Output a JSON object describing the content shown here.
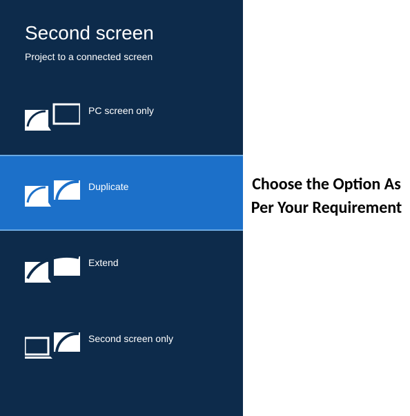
{
  "panel": {
    "title": "Second screen",
    "subtitle": "Project to a connected screen",
    "options": [
      {
        "label": "PC screen only"
      },
      {
        "label": "Duplicate"
      },
      {
        "label": "Extend"
      },
      {
        "label": "Second screen only"
      }
    ],
    "selected_index": 1
  },
  "annotation": {
    "text": "Choose the Option As Per Your Requirement"
  },
  "colors": {
    "panel_bg": "#0d2b4b",
    "selected_bg": "#1c70c9",
    "selected_border": "#6aa9e2",
    "text": "#ffffff"
  }
}
